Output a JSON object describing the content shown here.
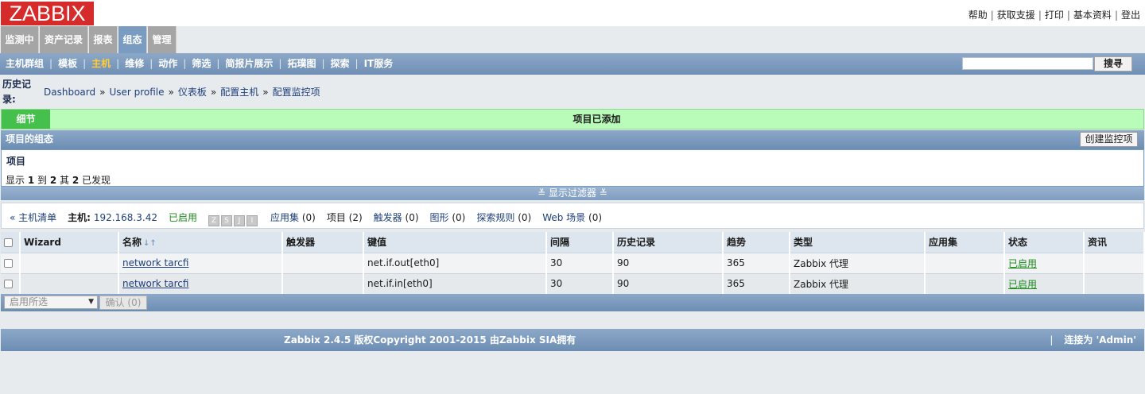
{
  "header": {
    "logo": "ZABBIX",
    "links": [
      "帮助",
      "获取支援",
      "打印",
      "基本资料",
      "登出"
    ]
  },
  "main_tabs": [
    "监测中",
    "资产记录",
    "报表",
    "组态",
    "管理"
  ],
  "sub_nav": [
    "主机群组",
    "模板",
    "主机",
    "维修",
    "动作",
    "筛选",
    "简报片展示",
    "拓璞图",
    "探索",
    "IT服务"
  ],
  "search": {
    "button": "搜寻",
    "value": ""
  },
  "history": {
    "label": "历史记录:",
    "crumbs": [
      "Dashboard",
      "User profile",
      "仪表板",
      "配置主机",
      "配置监控项"
    ]
  },
  "message": {
    "details": "细节",
    "text": "项目已添加"
  },
  "config": {
    "title": "项目的组态",
    "create_button": "创建监控项"
  },
  "items": {
    "title": "项目",
    "count_text": [
      "显示 ",
      "1",
      " 到 ",
      "2",
      " 其 ",
      "2",
      " 已发现"
    ]
  },
  "filter_toggle": "≚ 显示过滤器 ≚",
  "host_line": {
    "back": "« 主机清单",
    "host_label": "主机:",
    "host": "192.168.3.42",
    "status": "已启用",
    "status_icons": [
      "Z",
      "S",
      "J",
      "I"
    ],
    "apps": "应用集",
    "apps_count": "(0)",
    "items": "项目",
    "items_count": "(2)",
    "triggers": "触发器",
    "triggers_count": "(0)",
    "graphs": "图形",
    "graphs_count": "(0)",
    "discovery": "探索规则",
    "discovery_count": "(0)",
    "web": "Web 场景",
    "web_count": "(0)"
  },
  "table": {
    "headers": [
      "",
      "Wizard",
      "名称",
      "触发器",
      "键值",
      "间隔",
      "历史记录",
      "趋势",
      "类型",
      "应用集",
      "状态",
      "资讯"
    ],
    "rows": [
      {
        "name": "network tarcfi",
        "triggers": "",
        "key": "net.if.out[eth0]",
        "interval": "30",
        "history": "90",
        "trends": "365",
        "type": "Zabbix 代理",
        "apps": "",
        "status": "已启用",
        "info": ""
      },
      {
        "name": "network tarcfi",
        "triggers": "",
        "key": "net.if.in[eth0]",
        "interval": "30",
        "history": "90",
        "trends": "365",
        "type": "Zabbix 代理",
        "apps": "",
        "status": "已启用",
        "info": ""
      }
    ]
  },
  "actions": {
    "select": "启用所选",
    "confirm": "确认 (0)"
  },
  "footer": {
    "copyright": "Zabbix 2.4.5 版权Copyright 2001-2015 由Zabbix SIA拥有",
    "connected": "连接为 'Admin'"
  }
}
